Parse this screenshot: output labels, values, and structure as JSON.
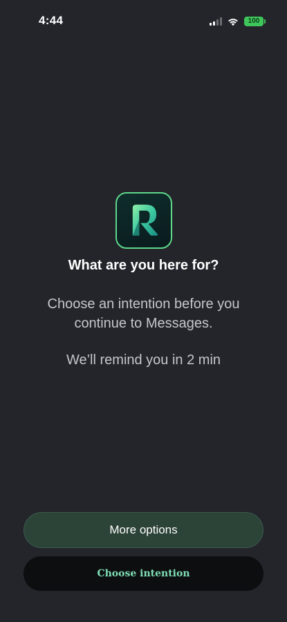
{
  "status_bar": {
    "time": "4:44",
    "battery_level": "100",
    "signal_icon": "cellular-signal-icon",
    "wifi_icon": "wifi-icon",
    "battery_icon": "battery-icon",
    "battery_color": "#3fc65a"
  },
  "app": {
    "icon": "app-logo-icon",
    "accent_color": "#5fd88a"
  },
  "prompt": {
    "title": "What are you here for?",
    "subtitle": "Choose an intention before you continue to Messages.",
    "reminder": "We’ll remind you in 2 min"
  },
  "actions": {
    "more_options_label": "More options",
    "choose_intention_label": "Choose intention"
  }
}
